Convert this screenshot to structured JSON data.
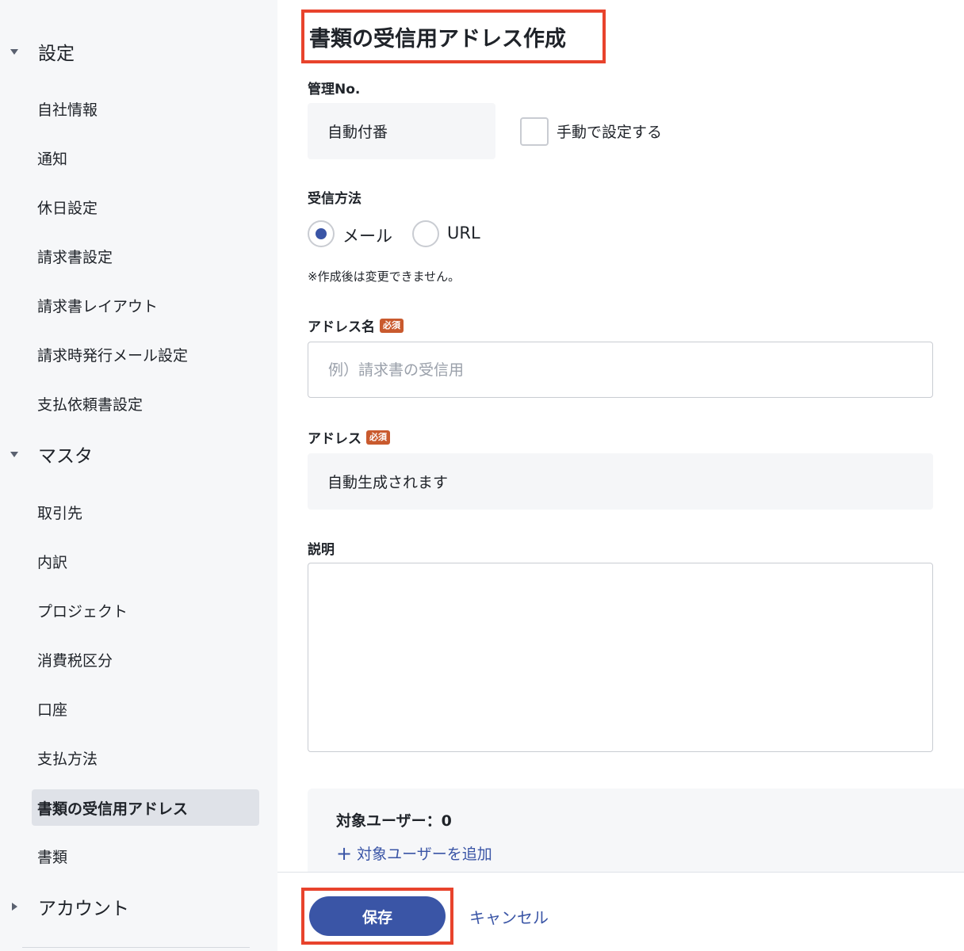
{
  "sidebar": {
    "sections": [
      {
        "label": "設定",
        "expanded": true
      },
      {
        "label": "マスタ",
        "expanded": true
      },
      {
        "label": "アカウント",
        "expanded": false
      }
    ],
    "settings_items": [
      {
        "label": "自社情報"
      },
      {
        "label": "通知"
      },
      {
        "label": "休日設定"
      },
      {
        "label": "請求書設定"
      },
      {
        "label": "請求書レイアウト"
      },
      {
        "label": "請求時発行メール設定"
      },
      {
        "label": "支払依頼書設定"
      }
    ],
    "master_items": [
      {
        "label": "取引先"
      },
      {
        "label": "内訳"
      },
      {
        "label": "プロジェクト"
      },
      {
        "label": "消費税区分"
      },
      {
        "label": "口座"
      },
      {
        "label": "支払方法"
      },
      {
        "label": "書類の受信用アドレス",
        "active": true
      },
      {
        "label": "書類"
      }
    ]
  },
  "page": {
    "title": "書類の受信用アドレス作成"
  },
  "form": {
    "management_no": {
      "label": "管理No.",
      "value": "自動付番",
      "manual_checkbox_label": "手動で設定する",
      "manual_checked": false
    },
    "receive_method": {
      "label": "受信方法",
      "options": [
        {
          "label": "メール",
          "selected": true
        },
        {
          "label": "URL",
          "selected": false
        }
      ],
      "note": "※作成後は変更できません。"
    },
    "address_name": {
      "label": "アドレス名",
      "required_badge": "必須",
      "placeholder": "例）請求書の受信用",
      "value": ""
    },
    "address": {
      "label": "アドレス",
      "required_badge": "必須",
      "value": "自動生成されます"
    },
    "description": {
      "label": "説明",
      "value": ""
    },
    "target_users": {
      "count_label": "対象ユーザー：0",
      "add_label": "対象ユーザーを追加"
    }
  },
  "footer": {
    "save_label": "保存",
    "cancel_label": "キャンセル"
  },
  "colors": {
    "accent": "#3a55a6",
    "highlight_outline": "#e8432c",
    "required_badge": "#c95a2e",
    "sidebar_bg": "#f6f7f9",
    "active_item_bg": "#dfe2e8"
  }
}
